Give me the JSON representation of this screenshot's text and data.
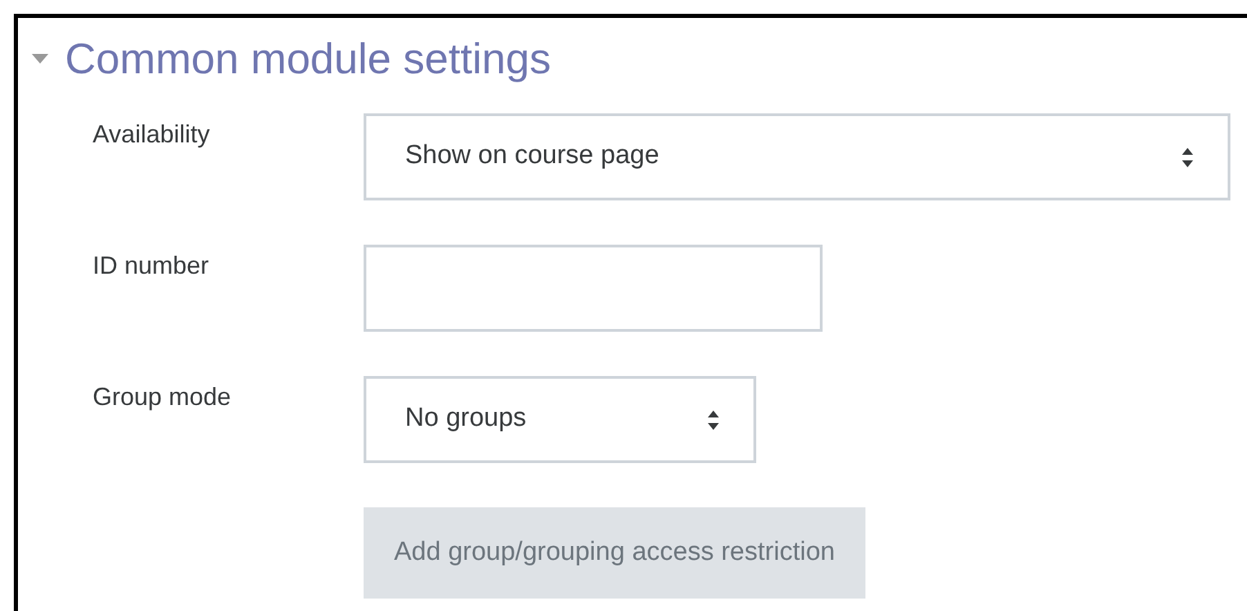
{
  "section": {
    "title": "Common module settings",
    "expanded": true
  },
  "fields": [
    {
      "label": "Availability",
      "kind": "select",
      "value": "Show on course page"
    },
    {
      "label": "ID number",
      "kind": "text"
    },
    {
      "label": "Group mode",
      "kind": "select",
      "value": "No groups"
    }
  ],
  "button": {
    "label": "Add group/grouping access restriction",
    "disabled": true
  }
}
